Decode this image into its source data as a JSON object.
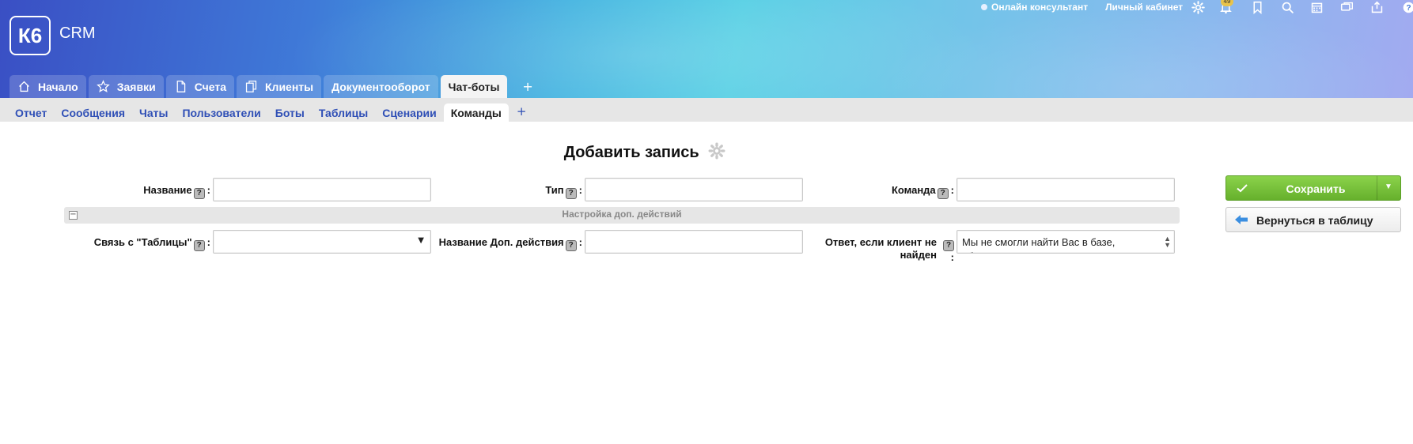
{
  "app": {
    "logo": "К6",
    "name": "CRM"
  },
  "top": {
    "online": "Онлайн консультант",
    "cabinet": "Личный кабинет",
    "notifications_count": "49"
  },
  "main_tabs": [
    {
      "label": "Начало",
      "icon": "home-icon"
    },
    {
      "label": "Заявки",
      "icon": "star-icon"
    },
    {
      "label": "Счета",
      "icon": "document-icon"
    },
    {
      "label": "Клиенты",
      "icon": "copy-icon"
    },
    {
      "label": "Документооборот",
      "icon": ""
    },
    {
      "label": "Чат-боты",
      "icon": "",
      "active": true
    }
  ],
  "add_tab": "+",
  "sub_tabs": [
    {
      "label": "Отчет"
    },
    {
      "label": "Сообщения"
    },
    {
      "label": "Чаты"
    },
    {
      "label": "Пользователи"
    },
    {
      "label": "Боты"
    },
    {
      "label": "Таблицы"
    },
    {
      "label": "Сценарии"
    },
    {
      "label": "Команды",
      "active": true
    }
  ],
  "form": {
    "title": "Добавить запись",
    "help": "?",
    "colon": ":",
    "fields": {
      "name": {
        "label": "Название",
        "value": ""
      },
      "type": {
        "label": "Тип",
        "value": ""
      },
      "command": {
        "label": "Команда",
        "value": ""
      },
      "relation": {
        "label": "Связь с \"Таблицы\"",
        "value": ""
      },
      "action_name": {
        "label": "Название Доп. действия",
        "value": ""
      },
      "not_found_answer": {
        "label": "Ответ, если клиент не найден",
        "value": "Мы не смогли найти Вас в базе, обратитесь в Поддержку"
      }
    },
    "section": {
      "title": "Настройка доп. действий",
      "collapse": "−"
    }
  },
  "buttons": {
    "save": "Сохранить",
    "back": "Вернуться в таблицу"
  },
  "colors": {
    "save_green": "#6dbb33",
    "link_blue": "#2f4fb6"
  }
}
